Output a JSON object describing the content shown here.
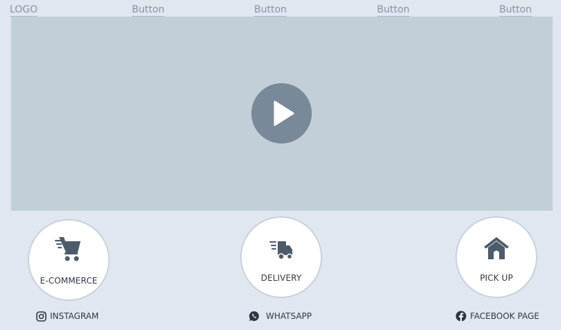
{
  "nav": {
    "logo": "LOGO",
    "buttons": [
      "Button",
      "Button",
      "Button",
      "Button"
    ]
  },
  "hero": {
    "play_icon": "play-icon"
  },
  "services": [
    {
      "label": "E-COMMERCE",
      "icon": "shopping-cart-icon"
    },
    {
      "label": "DELIVERY",
      "icon": "delivery-truck-icon"
    },
    {
      "label": "PICK UP",
      "icon": "house-icon"
    }
  ],
  "social": [
    {
      "label": "INSTAGRAM",
      "icon": "instagram-icon"
    },
    {
      "label": "WHATSAPP",
      "icon": "whatsapp-icon"
    },
    {
      "label": "FACEBOOK PAGE",
      "icon": "facebook-icon"
    }
  ],
  "colors": {
    "background": "#e1e7ef",
    "hero": "#c2cfd8",
    "play_button": "#7a8999",
    "icon": "#4e5b6b"
  }
}
